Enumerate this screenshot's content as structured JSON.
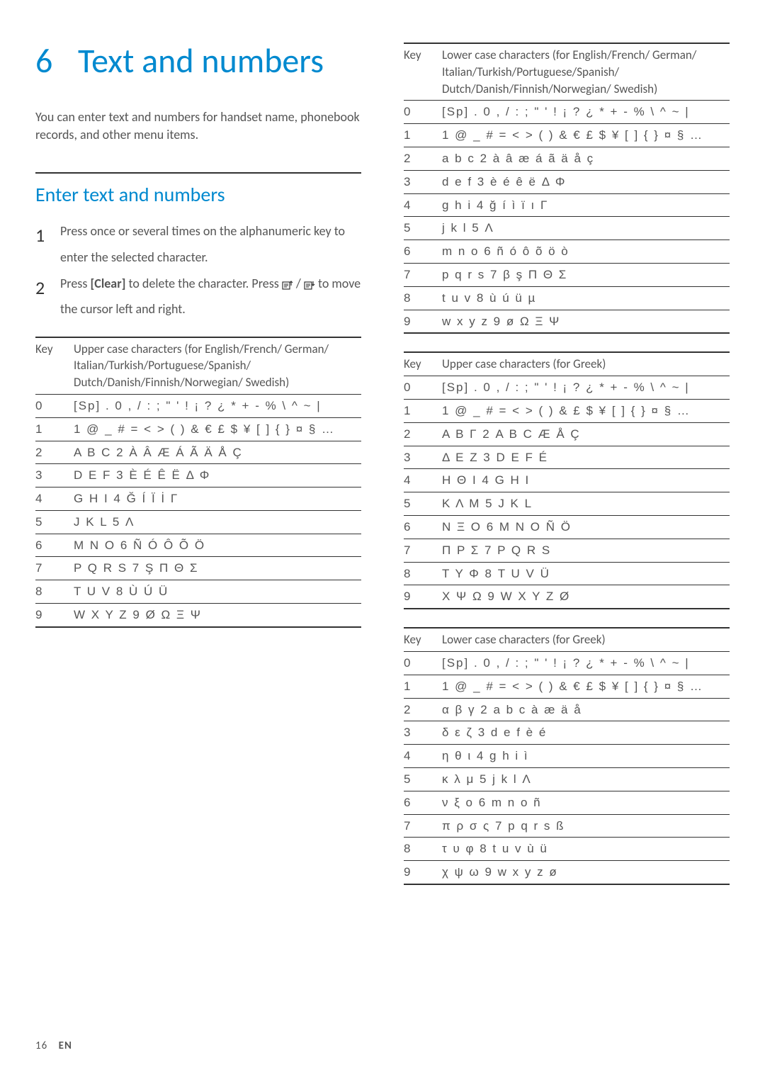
{
  "chapter": {
    "number": "6",
    "title": "Text and numbers"
  },
  "intro": "You can enter text and numbers for handset name, phonebook records, and other menu items.",
  "section": "Enter text and numbers",
  "steps": [
    {
      "n": "1",
      "text_a": "Press once or several times on the alphanumeric key to enter the selected character."
    },
    {
      "n": "2",
      "text_a": "Press ",
      "clear": "[Clear]",
      "text_b": " to delete the character. Press ",
      "text_c": " / ",
      "text_d": " to move the cursor left and right."
    }
  ],
  "tables": {
    "upper_euro": {
      "key_h": "Key",
      "char_h": "Upper case characters (for English/French/ German/ Italian/Turkish/Portuguese/Spanish/ Dutch/Danish/Finnish/Norwegian/ Swedish)",
      "rows": [
        {
          "k": "0",
          "v": "[Sp] . 0 , / : ; \" ' ! ¡ ? ¿ * + - % \\ ^ ~ |"
        },
        {
          "k": "1",
          "v": "1 @ _ # = < > ( ) & € £ $ ¥ [ ] { } ¤ § …"
        },
        {
          "k": "2",
          "v": "A B C 2 À Â Æ Á Ã Ä Å Ç"
        },
        {
          "k": "3",
          "v": "D E F 3 È É Ê Ë Δ Φ"
        },
        {
          "k": "4",
          "v": "G H I 4 Ğ Í Ï İ Γ"
        },
        {
          "k": "5",
          "v": "J K L 5 Λ"
        },
        {
          "k": "6",
          "v": "M N O 6 Ñ Ó Ô Õ Ö"
        },
        {
          "k": "7",
          "v": "P Q R S 7 Ş Π Θ Σ"
        },
        {
          "k": "8",
          "v": "T U V 8 Ù Ú Ü"
        },
        {
          "k": "9",
          "v": "W X Y Z 9 Ø Ω Ξ Ψ"
        }
      ]
    },
    "lower_euro": {
      "key_h": "Key",
      "char_h": "Lower case characters (for English/French/ German/ Italian/Turkish/Portuguese/Spanish/ Dutch/Danish/Finnish/Norwegian/ Swedish)",
      "rows": [
        {
          "k": "0",
          "v": "[Sp] . 0 , / : ; \" ' ! ¡ ? ¿ * + - % \\ ^ ~ |"
        },
        {
          "k": "1",
          "v": "1 @ _ # = < > ( ) & € £ $ ¥ [ ] { } ¤ § …"
        },
        {
          "k": "2",
          "v": "a b c 2 à â æ á ã ä å ç"
        },
        {
          "k": "3",
          "v": "d e f 3 è é ê ë Δ Φ"
        },
        {
          "k": "4",
          "v": "g h i 4 ğ í ì ï ı Γ"
        },
        {
          "k": "5",
          "v": "j k l 5 Λ"
        },
        {
          "k": "6",
          "v": "m n o 6 ñ ó ô õ ö ò"
        },
        {
          "k": "7",
          "v": "p q r s 7 β ş Π Θ Σ"
        },
        {
          "k": "8",
          "v": "t u v 8 ù ú ü µ"
        },
        {
          "k": "9",
          "v": "w x y z 9 ø Ω Ξ Ψ"
        }
      ]
    },
    "upper_greek": {
      "key_h": "Key",
      "char_h": "Upper case characters (for Greek)",
      "rows": [
        {
          "k": "0",
          "v": "[Sp] . 0 , / : ; \" ' ! ¡ ? ¿ * + - % \\ ^ ~ |"
        },
        {
          "k": "1",
          "v": "1 @ _ # = < > ( ) & £ $ ¥ [ ] { } ¤ § …"
        },
        {
          "k": "2",
          "v": "Α Β Γ 2 A B C Æ Å Ç"
        },
        {
          "k": "3",
          "v": "Δ Ε Ζ 3 D E F É"
        },
        {
          "k": "4",
          "v": "Η Θ Ι 4 G H I"
        },
        {
          "k": "5",
          "v": "Κ Λ Μ 5 J K L"
        },
        {
          "k": "6",
          "v": "Ν Ξ Ο 6 M N O Ñ Ö"
        },
        {
          "k": "7",
          "v": "Π Ρ Σ 7 P Q R S"
        },
        {
          "k": "8",
          "v": "Τ Υ Φ 8 T U V Ü"
        },
        {
          "k": "9",
          "v": "Χ Ψ Ω 9 W X Y Z Ø"
        }
      ]
    },
    "lower_greek": {
      "key_h": "Key",
      "char_h": "Lower case characters (for Greek)",
      "rows": [
        {
          "k": "0",
          "v": "[Sp] . 0 , / : ; \" ' ! ¡ ? ¿ * + - % \\ ^ ~ |"
        },
        {
          "k": "1",
          "v": "1 @ _ # = < > ( ) & € £ $ ¥ [ ] { } ¤ § …"
        },
        {
          "k": "2",
          "v": "α β γ 2 a b c à æ ä å"
        },
        {
          "k": "3",
          "v": "δ ε ζ 3 d e f è é"
        },
        {
          "k": "4",
          "v": "η θ ι 4 g h i ì"
        },
        {
          "k": "5",
          "v": "κ λ μ 5 j k l Λ"
        },
        {
          "k": "6",
          "v": "ν ξ ο 6 m n o ñ"
        },
        {
          "k": "7",
          "v": "π ρ σ ς 7 p q r s ß"
        },
        {
          "k": "8",
          "v": "τ υ φ 8 t u v ù ü"
        },
        {
          "k": "9",
          "v": "χ ψ ω 9 w x y z ø"
        }
      ]
    }
  },
  "footer": {
    "page": "16",
    "lang": "EN"
  }
}
